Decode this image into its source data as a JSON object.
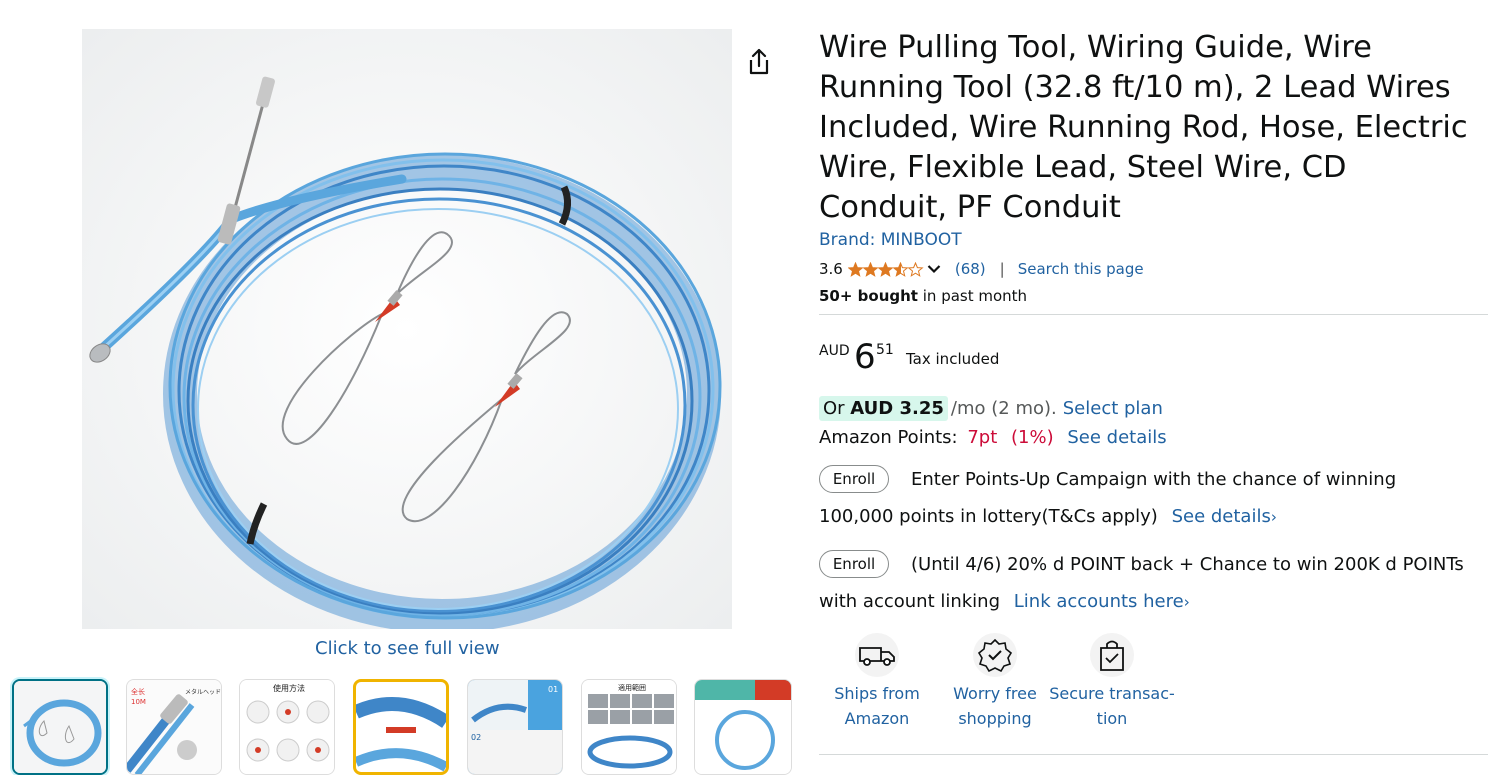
{
  "product": {
    "title": "Wire Pulling Tool, Wiring Guide, Wire Running Tool (32.8 ft/10 m), 2 Lead Wires Included, Wire Running Rod, Hose, Electric Wire, Flexible Lead, Steel Wire, CD Conduit, PF Conduit",
    "brand": "Brand: MINBOOT",
    "rating_value": "3.6",
    "rating_stars": 3.6,
    "rating_count": "(68)",
    "rating_sep": "|",
    "search_link": "Search this page",
    "bought_bold": "50+ bought",
    "bought_rest": " in past month"
  },
  "gallery": {
    "full_view": "Click to see full view",
    "thumbnails": [
      {
        "label": "thumb-1",
        "selected": true
      },
      {
        "label": "thumb-2",
        "text_1": "全长",
        "text_2": "10M",
        "text_3": "メタルヘッド"
      },
      {
        "label": "thumb-3",
        "text_1": "使用方法"
      },
      {
        "label": "thumb-4"
      },
      {
        "label": "thumb-5",
        "badge_1": "01",
        "badge_2": "02"
      },
      {
        "label": "thumb-6",
        "text_1": "適用範囲"
      },
      {
        "label": "thumb-7"
      }
    ]
  },
  "price": {
    "currency": "AUD",
    "whole": "6",
    "fraction": "51",
    "tax_note": "Tax included"
  },
  "plan": {
    "prefix": "Or ",
    "amount": "AUD 3.25",
    "suffix": "/mo (2 mo).",
    "link": "Select plan"
  },
  "points": {
    "label": "Amazon Points:",
    "value": "7pt",
    "percent": "(1%)",
    "link": "See details"
  },
  "promos": [
    {
      "button": "Enroll",
      "text": "Enter Points-Up Campaign with the chance of winning 100,000 points in lottery(T&Cs apply)",
      "link": "See details"
    },
    {
      "button": "Enroll",
      "text": "(Until 4/6) 20% d POINT back + Chance to win 200K d POINTs with account linking",
      "link": "Link accounts here"
    }
  ],
  "features": [
    {
      "line1": "Ships from",
      "line2": "Amazon",
      "icon": "delivery-van-icon"
    },
    {
      "line1": "Worry free",
      "line2": "shopping",
      "icon": "verified-badge-icon"
    },
    {
      "line1": "Secure transac-",
      "line2": "tion",
      "icon": "secure-bag-icon"
    }
  ],
  "colors": {
    "link": "#2162a1",
    "points": "#cc0c39",
    "emi_bg": "#d7f7ec",
    "star": "#de7921",
    "thumb_selected": "#007185"
  }
}
